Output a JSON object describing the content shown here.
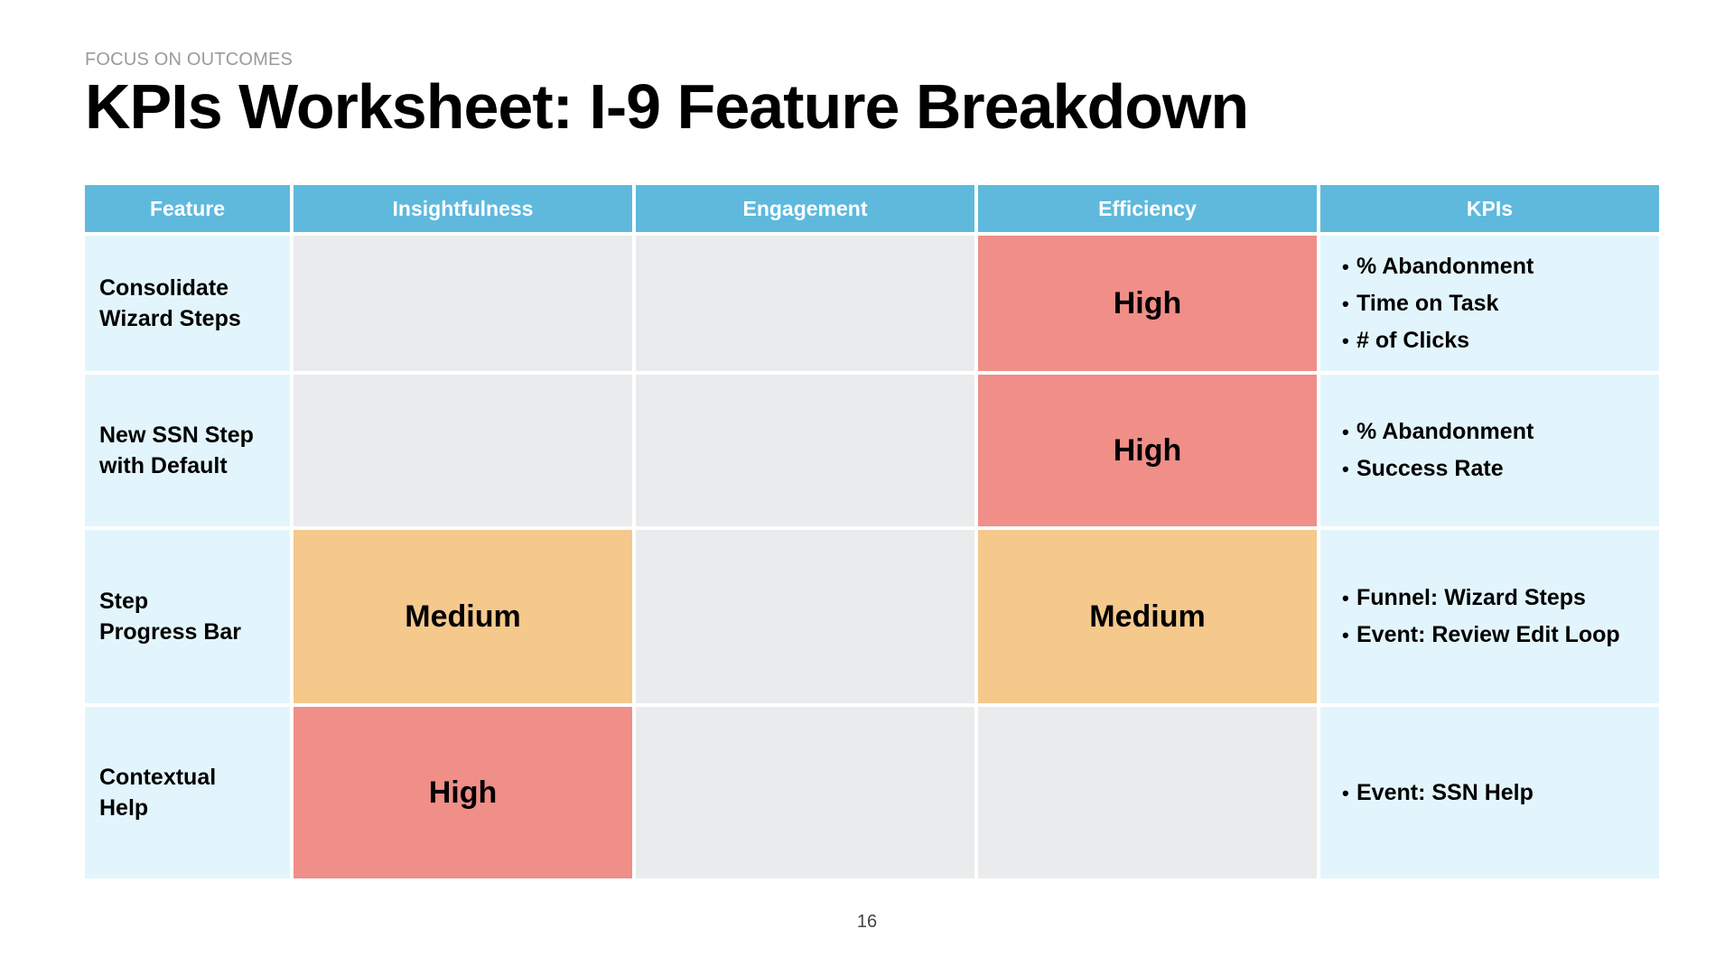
{
  "slide": {
    "eyebrow": "FOCUS ON OUTCOMES",
    "title": "KPIs Worksheet: I-9 Feature Breakdown",
    "page_number": "16"
  },
  "table": {
    "headers": [
      "Feature",
      "Insightfulness",
      "Engagement",
      "Efficiency",
      "KPIs"
    ],
    "rows": [
      {
        "feature": "Consolidate\nWizard Steps",
        "insightfulness": "",
        "engagement": "",
        "efficiency": "High",
        "kpis": [
          "% Abandonment",
          "Time on Task",
          "# of Clicks"
        ]
      },
      {
        "feature": "New SSN Step\nwith Default",
        "insightfulness": "",
        "engagement": "",
        "efficiency": "High",
        "kpis": [
          "% Abandonment",
          "Success Rate"
        ]
      },
      {
        "feature": "Step\nProgress Bar",
        "insightfulness": "Medium",
        "engagement": "",
        "efficiency": "Medium",
        "kpis": [
          "Funnel: Wizard Steps",
          "Event: Review Edit Loop"
        ]
      },
      {
        "feature": "Contextual\nHelp",
        "insightfulness": "High",
        "engagement": "",
        "efficiency": "",
        "kpis": [
          "Event: SSN Help"
        ]
      }
    ],
    "bullet": "•"
  },
  "colors": {
    "header": "#5fb9dd",
    "feature_bg": "#e3f5fc",
    "empty_bg": "#eaebec",
    "high": "#f08e88",
    "medium": "#f5c88c"
  }
}
